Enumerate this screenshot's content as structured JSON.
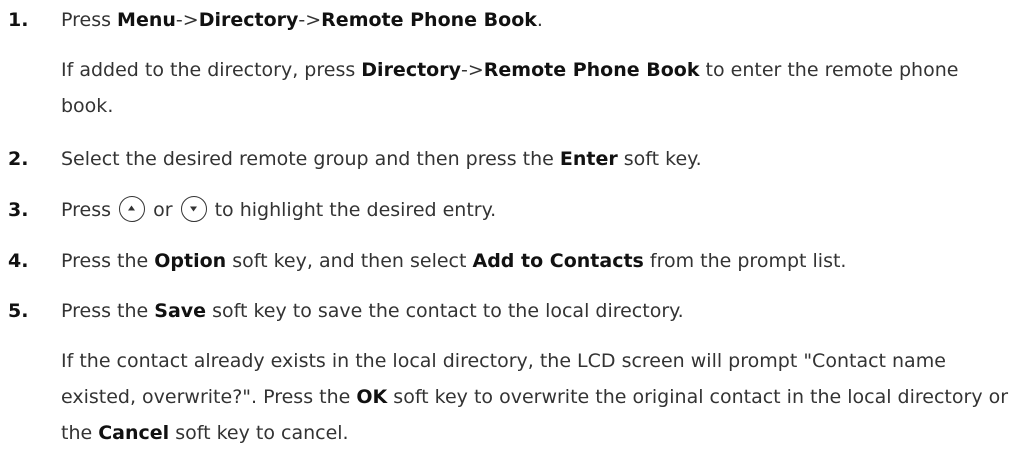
{
  "steps": [
    {
      "number": "1.",
      "line": {
        "t1": "Press ",
        "b1": "Menu",
        "t2": "->",
        "b2": "Directory",
        "t3": "->",
        "b3": "Remote Phone Book",
        "t4": "."
      },
      "note": {
        "t1": "If added to the directory, press ",
        "b1": "Directory",
        "t2": "->",
        "b2": "Remote Phone Book",
        "t3": " to enter the remote phone book."
      }
    },
    {
      "number": "2.",
      "line": {
        "t1": "Select the desired remote group and then press the ",
        "b1": "Enter",
        "t2": " soft key."
      }
    },
    {
      "number": "3.",
      "line": {
        "t1": "Press ",
        "t2": " or ",
        "t3": " to highlight the desired entry."
      },
      "icons": [
        "up-arrow-key-icon",
        "down-arrow-key-icon"
      ]
    },
    {
      "number": "4.",
      "line": {
        "t1": "Press the ",
        "b1": "Option",
        "t2": " soft key, and then select ",
        "b2": "Add to Contacts",
        "t3": " from the prompt list."
      }
    },
    {
      "number": "5.",
      "line": {
        "t1": "Press the ",
        "b1": "Save",
        "t2": " soft key to save the contact to the local directory."
      },
      "note": {
        "t1": "If the contact already exists in the local directory, the LCD screen will prompt \"Contact name existed, overwrite?\". Press the ",
        "b1": "OK",
        "t2": " soft key to overwrite the original contact in the local directory or the ",
        "b2": "Cancel",
        "t3": " soft key to cancel."
      }
    }
  ]
}
